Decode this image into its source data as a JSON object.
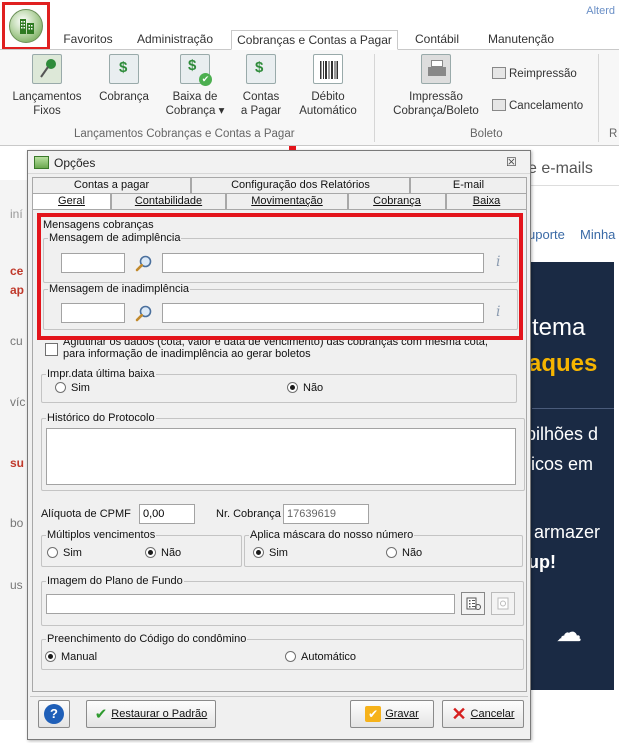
{
  "window": {
    "title_partial": "Alterd"
  },
  "ribbon": {
    "tabs": [
      "Favoritos",
      "Administração",
      "Cobranças e Contas a Pagar",
      "Contábil",
      "Manutenção"
    ],
    "active_tab": "Cobranças e Contas a Pagar",
    "buttons": {
      "lancamentos_fixos": "Lançamentos\nFixos",
      "cobranca": "Cobrança",
      "baixa_cobranca": "Baixa de\nCobrança ▾",
      "contas_pagar": "Contas\na Pagar",
      "debito_automatico": "Débito\nAutomático",
      "impressao": "Impressão\nCobrança/Boleto",
      "reimpressao": "Reimpressão",
      "cancelamento": "Cancelamento"
    },
    "groups": {
      "lancamentos": "Lançamentos Cobranças e Contas a Pagar",
      "boleto": "Boleto",
      "partial": "R"
    }
  },
  "background": {
    "left_items": [
      "iní",
      "ce",
      "ap",
      "cu",
      "víc",
      "su",
      "bo",
      "us"
    ],
    "right_tab_partial": "e e-mails",
    "right_panel": {
      "suporte": "uporte",
      "minha": "Minha",
      "tema": "tema",
      "aques": "aques",
      "bilhoes": "bilhões d",
      "ticos": "ticos em",
      "armazer": "armazer",
      "up": "up!"
    }
  },
  "dialog": {
    "title": "Opções",
    "close_glyph": "☒",
    "tabs_row1": [
      "Contas a pagar",
      "Configuração dos Relatórios",
      "E-mail"
    ],
    "tabs_row2": [
      "Geral",
      "Contabilidade",
      "Movimentação",
      "Cobrança",
      "Baixa"
    ],
    "selected_tab": "Geral",
    "mensagens": {
      "group_label": "Mensagens cobranças",
      "adimplencia_label": "Mensagem de adimplência",
      "adimplencia_code": "",
      "adimplencia_text": "",
      "inadimplencia_label": "Mensagem de inadimplência",
      "inadimplencia_code": "",
      "inadimplencia_text": ""
    },
    "aglutinar_label": "Aglutinar os dados (cota, valor e data de vencimento) das cobranças com mesma cota, para informação de inadimplência ao gerar boletos",
    "aglutinar_checked": false,
    "impr_data": {
      "label": "Impr.data última baixa",
      "options": [
        "Sim",
        "Não"
      ],
      "selected": "Não"
    },
    "historico": {
      "label": "Histórico do Protocolo",
      "value": ""
    },
    "aliquota": {
      "label": "Alíquota de CPMF",
      "value": "0,00"
    },
    "nr_cobranca": {
      "label": "Nr. Cobrança",
      "value": "17639619"
    },
    "multiplos": {
      "label": "Múltiplos vencimentos",
      "options": [
        "Sim",
        "Não"
      ],
      "selected": "Não"
    },
    "mascara": {
      "label": "Aplica máscara do nosso número",
      "options": [
        "Sim",
        "Não"
      ],
      "selected": "Sim"
    },
    "imagem": {
      "label": "Imagem do Plano de Fundo",
      "value": ""
    },
    "preenchimento": {
      "label": "Preenchimento do Código do condômino",
      "options": [
        "Manual",
        "Automático"
      ],
      "selected": "Manual"
    },
    "buttons": {
      "help": "?",
      "restaurar": "Restaurar o Padrão",
      "gravar": "Gravar",
      "cancelar": "Cancelar"
    }
  },
  "colors": {
    "highlight": "#e3141b",
    "accent": "#2a6db5"
  }
}
